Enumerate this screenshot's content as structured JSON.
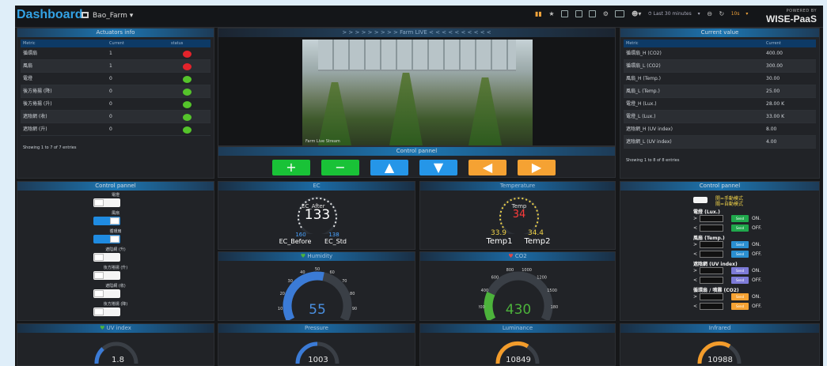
{
  "header": {
    "brand": "Dashboard",
    "dashboard_name": "Bao_Farm",
    "time_range": "Last 30 minutes",
    "refresh": "10s",
    "powered_by": "POWERED BY",
    "wise": "WISE-PaaS"
  },
  "actuators": {
    "title": "Actuators info",
    "col_metric": "Metric",
    "col_current": "Current",
    "col_status": "status",
    "rows": [
      {
        "metric": "循環扇",
        "current": "1",
        "status": "red"
      },
      {
        "metric": "風扇",
        "current": "1",
        "status": "red"
      },
      {
        "metric": "電燈",
        "current": "0",
        "status": "green"
      },
      {
        "metric": "後方捲揚 (降)",
        "current": "0",
        "status": "green"
      },
      {
        "metric": "後方捲揚 (升)",
        "current": "0",
        "status": "green"
      },
      {
        "metric": "遮陰網 (收)",
        "current": "0",
        "status": "green"
      },
      {
        "metric": "遮陰網 (升)",
        "current": "0",
        "status": "green"
      }
    ],
    "showing": "Showing 1 to 7 of 7 entries"
  },
  "live": {
    "title": "> > > > > > > > >  Farm LIVE  < < < < < < < < < <",
    "caption": "Farm Live Stream"
  },
  "control_top": {
    "title": "Control pannel",
    "buttons": [
      {
        "label": "+",
        "color": "#19c237"
      },
      {
        "label": "−",
        "color": "#19c237"
      },
      {
        "label": "▲",
        "color": "#2596e8"
      },
      {
        "label": "▼",
        "color": "#2596e8"
      },
      {
        "label": "◀",
        "color": "#f5a233"
      },
      {
        "label": "▶",
        "color": "#f5a233"
      }
    ]
  },
  "current_value": {
    "title": "Current value",
    "col_metric": "Metric",
    "col_current": "Current",
    "rows": [
      {
        "metric": "循環扇_H (CO2)",
        "current": "400.00"
      },
      {
        "metric": "循環扇_L (CO2)",
        "current": "300.00"
      },
      {
        "metric": "風扇_H (Temp.)",
        "current": "30.00"
      },
      {
        "metric": "風扇_L (Temp.)",
        "current": "25.00"
      },
      {
        "metric": "電燈_H (Lux.)",
        "current": "28.00 K"
      },
      {
        "metric": "電燈_L (Lux.)",
        "current": "33.00 K"
      },
      {
        "metric": "遮陰網_H (UV index)",
        "current": "8.00"
      },
      {
        "metric": "遮陰網_L (UV index)",
        "current": "4.00"
      }
    ],
    "showing": "Showing 1 to 8 of 8 entries"
  },
  "control_left": {
    "title": "Control pannel",
    "toggles": [
      {
        "label": "電燈",
        "on": false
      },
      {
        "label": "風扇",
        "on": true
      },
      {
        "label": "循環扇",
        "on": true
      },
      {
        "label": "遮陰網 (升)",
        "on": false
      },
      {
        "label": "後方捲揚 (升)",
        "on": false
      },
      {
        "label": "遮陰網 (收)",
        "on": false
      },
      {
        "label": "後方捲揚 (降)",
        "on": false
      }
    ]
  },
  "ec": {
    "title": "EC",
    "inner": "EC_After",
    "value": "133",
    "left_val": "160",
    "right_val": "138",
    "left_label": "EC_Before",
    "right_label": "EC_Std"
  },
  "temperature": {
    "title": "Temperature",
    "inner": "Temp",
    "value": "34",
    "left_val": "33.9",
    "right_val": "34.4",
    "left_label": "Temp1",
    "right_label": "Temp2"
  },
  "humidity": {
    "title": "Humidity",
    "value": "55",
    "ticks": [
      "0",
      "10",
      "20",
      "30",
      "40",
      "50",
      "60",
      "70",
      "80",
      "90",
      "100"
    ],
    "fraction": 0.55,
    "color": "#3b7bd6"
  },
  "co2": {
    "title": "CO2",
    "value": "430",
    "ticks": [
      "0",
      "200",
      "400",
      "600",
      "800",
      "1000",
      "1200",
      "1500",
      "1800",
      "2000"
    ],
    "fraction": 0.22,
    "color": "#4cb33b"
  },
  "uv": {
    "title": "UV index",
    "value": "1.8"
  },
  "pressure": {
    "title": "Pressure",
    "value": "1003"
  },
  "luminance": {
    "title": "Luminance",
    "value": "10849"
  },
  "infrared": {
    "title": "Infrared",
    "value": "10988"
  },
  "control_right": {
    "title": "Control pannel",
    "mode_manual": "開=手動模式",
    "mode_auto": "關=自動模式",
    "groups": [
      {
        "label": "電燈 (Lux.)",
        "color": "#20a84c"
      },
      {
        "label": "風扇 (Temp.)",
        "color": "#2a8fd0"
      },
      {
        "label": "遮陰網 (UV index)",
        "color": "#7d7bd8"
      },
      {
        "label": "循環扇 / 噴霧 (CO2)",
        "color": "#f5a233"
      }
    ],
    "send": "Send",
    "on": "ON.",
    "off": "OFF.",
    "gt": ">",
    "lt": "<"
  }
}
